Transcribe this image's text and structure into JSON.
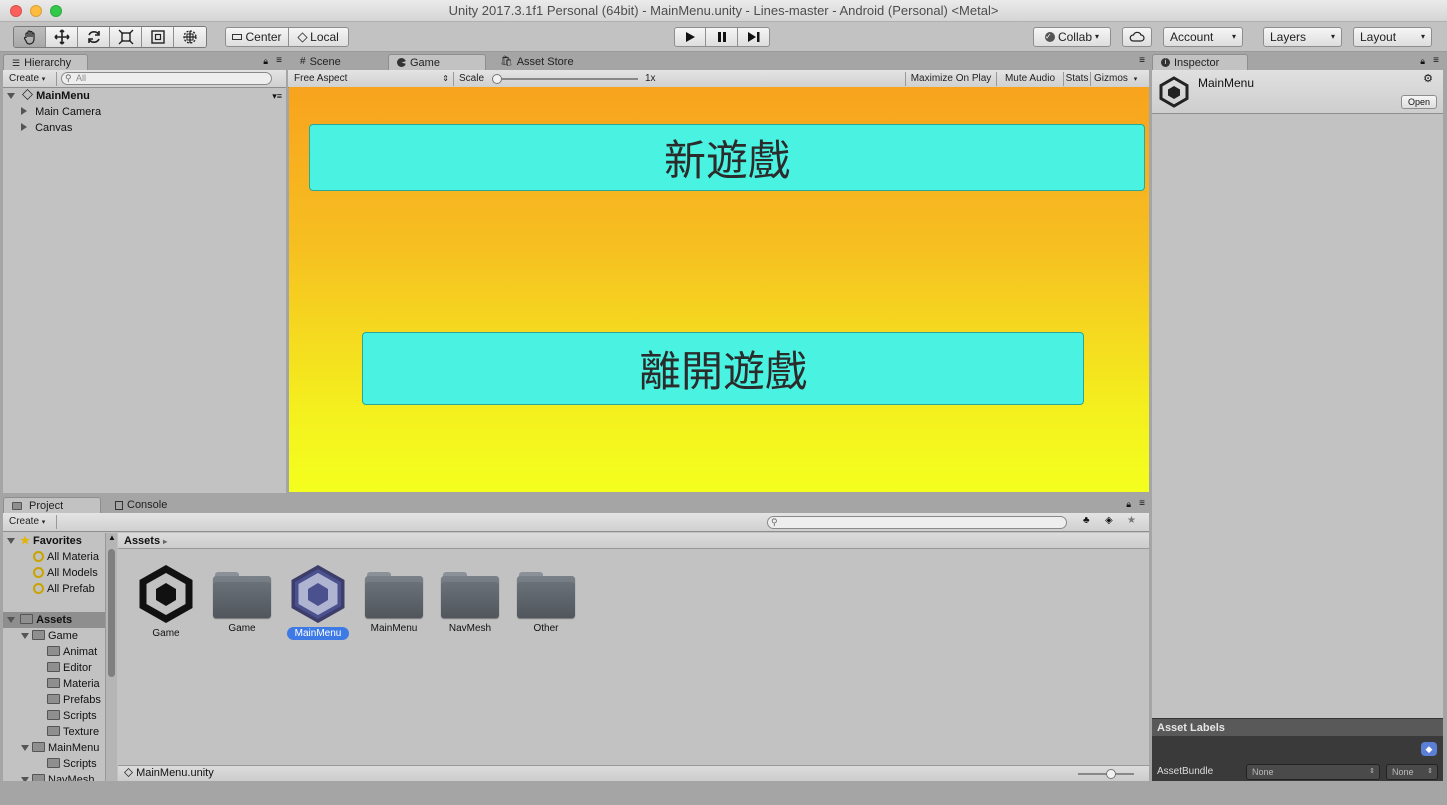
{
  "window": {
    "title": "Unity 2017.3.1f1 Personal (64bit) - MainMenu.unity - Lines-master - Android (Personal) <Metal>"
  },
  "toolbar": {
    "tools": [
      "hand-tool",
      "move-tool",
      "rotate-tool",
      "scale-tool",
      "rect-tool",
      "transform-tool"
    ],
    "pivot_label": "Center",
    "space_label": "Local",
    "collab_label": "Collab",
    "account_label": "Account",
    "layers_label": "Layers",
    "layout_label": "Layout"
  },
  "hierarchy": {
    "tab_label": "Hierarchy",
    "create_label": "Create",
    "search_placeholder": "All",
    "scene_name": "MainMenu",
    "items": [
      "Main Camera",
      "Canvas"
    ]
  },
  "center": {
    "tabs": [
      "Scene",
      "Game",
      "Asset Store"
    ],
    "aspect_label": "Free Aspect",
    "scale_label": "Scale",
    "scale_value": "1x",
    "scale_fraction": 0.0,
    "maximize_label": "Maximize On Play",
    "mute_label": "Mute Audio",
    "stats_label": "Stats",
    "gizmos_label": "Gizmos"
  },
  "game": {
    "new_game_label": "新遊戲",
    "exit_game_label": "離開遊戲",
    "gradient_top": "#f8a31e",
    "gradient_bottom": "#f4ff1e",
    "button_color": "#4af3e1"
  },
  "inspector": {
    "tab_label": "Inspector",
    "asset_name": "MainMenu",
    "open_label": "Open",
    "asset_labels_title": "Asset Labels",
    "asset_bundle_label": "AssetBundle",
    "bundle_value": "None",
    "variant_value": "None"
  },
  "project": {
    "tabs": [
      "Project",
      "Console"
    ],
    "create_label": "Create",
    "favorites_label": "Favorites",
    "favorites": [
      "All Materia",
      "All Models",
      "All Prefab"
    ],
    "assets_label": "Assets",
    "tree": [
      {
        "label": "Game",
        "level": 1
      },
      {
        "label": "Animat",
        "level": 2
      },
      {
        "label": "Editor",
        "level": 2
      },
      {
        "label": "Materia",
        "level": 2
      },
      {
        "label": "Prefabs",
        "level": 2
      },
      {
        "label": "Scripts",
        "level": 2
      },
      {
        "label": "Texture",
        "level": 2
      },
      {
        "label": "MainMenu",
        "level": 1
      },
      {
        "label": "Scripts",
        "level": 2
      },
      {
        "label": "NavMesh",
        "level": 1
      }
    ],
    "breadcrumb": "Assets",
    "assets": [
      {
        "label": "Game",
        "icon": "unity-scene-icon",
        "selected": false
      },
      {
        "label": "Game",
        "icon": "folder-icon",
        "selected": false
      },
      {
        "label": "MainMenu",
        "icon": "unity-scene-icon",
        "selected": true
      },
      {
        "label": "MainMenu",
        "icon": "folder-icon",
        "selected": false
      },
      {
        "label": "NavMesh",
        "icon": "folder-icon",
        "selected": false
      },
      {
        "label": "Other",
        "icon": "folder-icon",
        "selected": false
      }
    ],
    "footer_path": "MainMenu.unity",
    "icon_size_fraction": 0.6
  },
  "colors": {
    "selection": "#3d7ae5",
    "panel": "#c2c2c2"
  }
}
